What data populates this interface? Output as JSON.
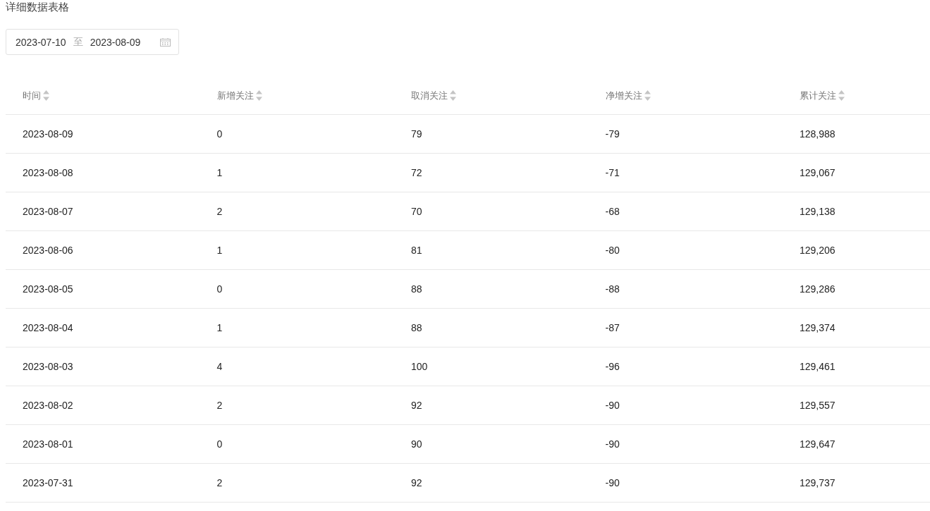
{
  "title": "详细数据表格",
  "date_range": {
    "start": "2023-07-10",
    "separator": "至",
    "end": "2023-08-09"
  },
  "table": {
    "columns": [
      "时间",
      "新增关注",
      "取消关注",
      "净增关注",
      "累计关注"
    ],
    "rows": [
      [
        "2023-08-09",
        "0",
        "79",
        "-79",
        "128,988"
      ],
      [
        "2023-08-08",
        "1",
        "72",
        "-71",
        "129,067"
      ],
      [
        "2023-08-07",
        "2",
        "70",
        "-68",
        "129,138"
      ],
      [
        "2023-08-06",
        "1",
        "81",
        "-80",
        "129,206"
      ],
      [
        "2023-08-05",
        "0",
        "88",
        "-88",
        "129,286"
      ],
      [
        "2023-08-04",
        "1",
        "88",
        "-87",
        "129,374"
      ],
      [
        "2023-08-03",
        "4",
        "100",
        "-96",
        "129,461"
      ],
      [
        "2023-08-02",
        "2",
        "92",
        "-90",
        "129,557"
      ],
      [
        "2023-08-01",
        "0",
        "90",
        "-90",
        "129,647"
      ],
      [
        "2023-07-31",
        "2",
        "92",
        "-90",
        "129,737"
      ]
    ]
  }
}
